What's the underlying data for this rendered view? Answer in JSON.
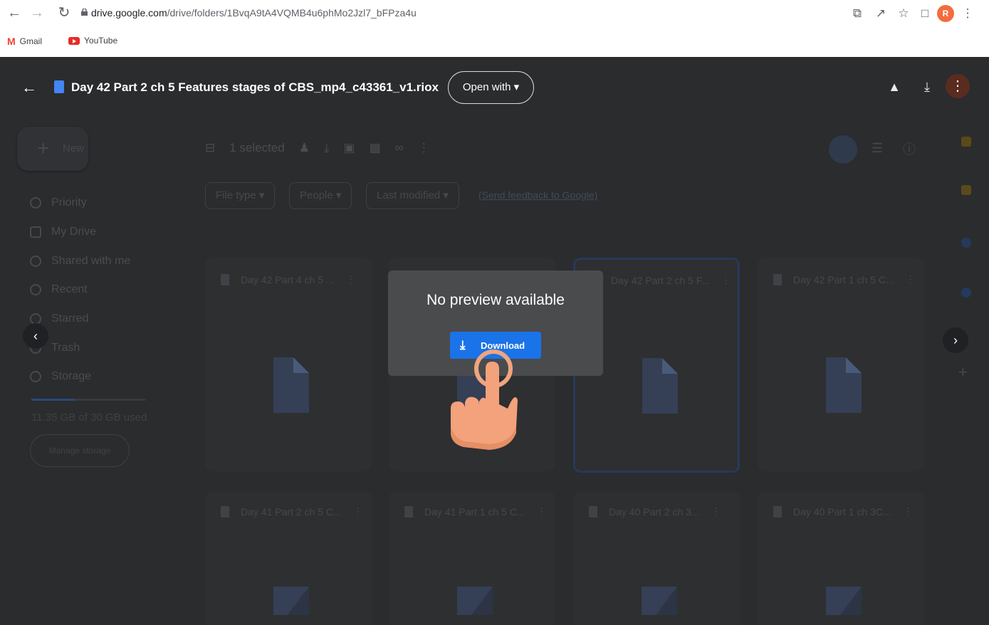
{
  "browser": {
    "url_host": "drive.google.com",
    "url_path": "/drive/folders/1BvqA9tA4VQMB4u6phMo2Jzl7_bFPza4u",
    "profile_initial": "R",
    "bookmarks": [
      {
        "label": "Gmail"
      },
      {
        "label": "YouTube"
      }
    ]
  },
  "viewer": {
    "title": "Day 42 Part 2 ch 5 Features stages of CBS_mp4_c43361_v1.riox",
    "open_with_label": "Open with",
    "dialog_title": "No preview available",
    "download_label": "Download"
  },
  "drive": {
    "new_label": "New",
    "sidebar": [
      {
        "label": "Priority"
      },
      {
        "label": "My Drive"
      },
      {
        "label": "Shared with me"
      },
      {
        "label": "Recent"
      },
      {
        "label": "Starred"
      },
      {
        "label": "Trash"
      },
      {
        "label": "Storage"
      }
    ],
    "storage_text": "11.35 GB of 30 GB used",
    "storage_fraction": 0.38,
    "manage_storage_label": "Manage storage",
    "selected_label": "1 selected",
    "filters": [
      {
        "label": "File type"
      },
      {
        "label": "People"
      },
      {
        "label": "Last modified"
      }
    ],
    "feedback_label": "(Send feedback to Google)",
    "files_row1": [
      {
        "name": "Day 42 Part 4 ch 5 ..."
      },
      {
        "name": ""
      },
      {
        "name": "Day 42 Part 2 ch 5 F..."
      },
      {
        "name": "Day 42 Part 1 ch 5 C..."
      }
    ],
    "files_row2": [
      {
        "name": "Day 41 Part 2 ch 5 C..."
      },
      {
        "name": "Day 41 Part 1 ch 5 C..."
      },
      {
        "name": "Day 40 Part 2 ch 3..."
      },
      {
        "name": "Day 40 Part 1 ch 3C..."
      }
    ]
  },
  "colors": {
    "accent": "#1a73e8",
    "overlay": "#2b2c2e",
    "dialog": "#4a4b4d"
  }
}
